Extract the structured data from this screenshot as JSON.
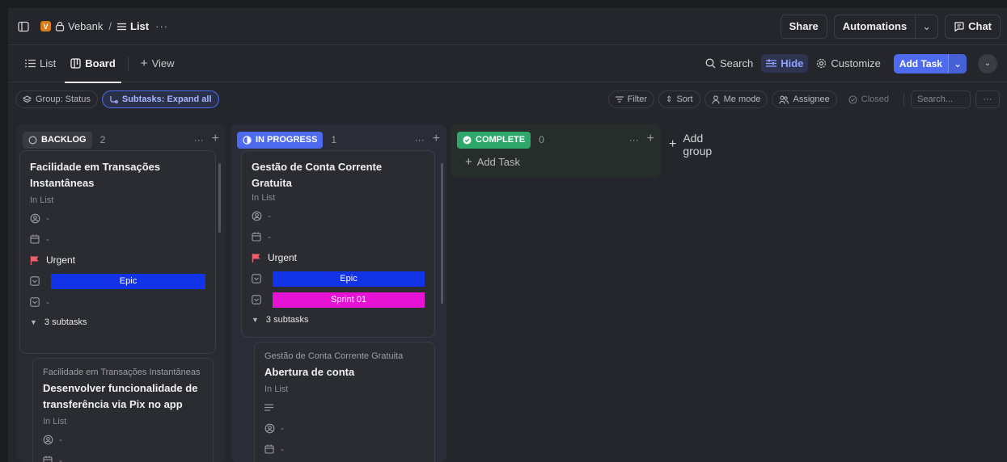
{
  "topbar": {
    "workspace_badge": "V",
    "space_name": "Vebank",
    "separator": "/",
    "list_name": "List",
    "more": "···",
    "share_label": "Share",
    "automations_label": "Automations",
    "chat_label": "Chat"
  },
  "viewbar": {
    "tabs": [
      {
        "label": "List"
      },
      {
        "label": "Board"
      },
      {
        "label": "View"
      }
    ],
    "search_label": "Search",
    "hide_label": "Hide",
    "customize_label": "Customize",
    "add_task_label": "Add Task"
  },
  "filterbar": {
    "group_label": "Group: Status",
    "subtasks_label": "Subtasks: Expand all",
    "filter_label": "Filter",
    "sort_label": "Sort",
    "me_mode_label": "Me mode",
    "assignee_label": "Assignee",
    "closed_label": "Closed",
    "search_placeholder": "Search...",
    "more": "···"
  },
  "colors": {
    "backlog": "#3a3b41",
    "in_progress": "#4e6bf0",
    "complete": "#2ea86a",
    "epic_tag": "#1233e6",
    "sprint_tag": "#e612d4",
    "urgent": "#f05d6b"
  },
  "columns": [
    {
      "status": "BACKLOG",
      "count": "2",
      "more": "···",
      "cards": [
        {
          "title": "Facilidade em Transações Instantâneas",
          "list": "In List",
          "assignee": "-",
          "date": "-",
          "priority": "Urgent",
          "tag1": "Epic",
          "tag2": "-",
          "subtasks": "3 subtasks"
        },
        {
          "parent": "Facilidade em Transações Instantâneas",
          "title": "Desenvolver funcionalidade de transferência via Pix no app",
          "list": "In List",
          "assignee": "-",
          "date": "-"
        }
      ]
    },
    {
      "status": "IN PROGRESS",
      "count": "1",
      "more": "···",
      "cards": [
        {
          "title": "Gestão de Conta Corrente Gratuita",
          "list": "In List",
          "assignee": "-",
          "date": "-",
          "priority": "Urgent",
          "tag1": "Epic",
          "tag2": "Sprint 01",
          "subtasks": "3 subtasks"
        },
        {
          "parent": "Gestão de Conta Corrente Gratuita",
          "title": "Abertura de conta",
          "list": "In List",
          "assignee": "-",
          "date": "-"
        }
      ]
    },
    {
      "status": "COMPLETE",
      "count": "0",
      "more": "···",
      "add_task_label": "Add Task"
    }
  ],
  "add_group_label": "Add group"
}
